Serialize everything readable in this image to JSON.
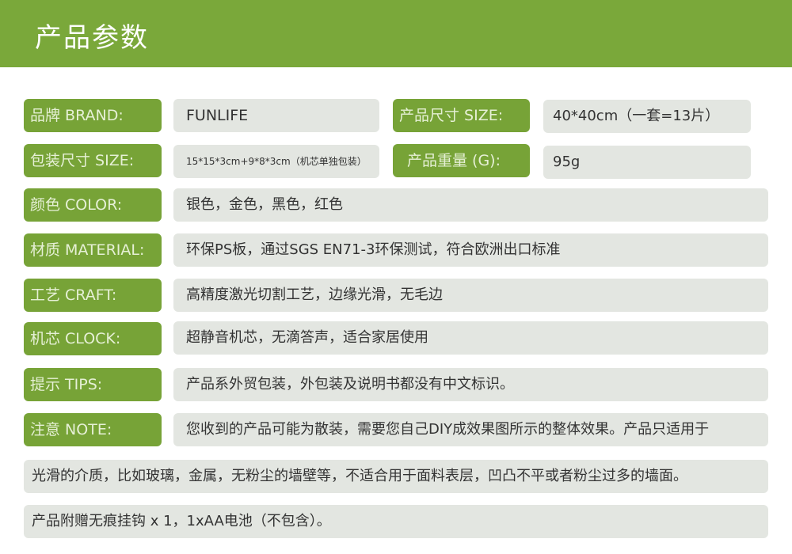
{
  "header": {
    "title": "产品参数"
  },
  "rows": {
    "brand": {
      "label": "品牌 BRAND:",
      "value": "FUNLIFE"
    },
    "size": {
      "label": "产品尺寸 SIZE:",
      "value": "40*40cm（一套=13片）"
    },
    "pack_size": {
      "label": "包装尺寸 SIZE:",
      "value": "15*15*3cm+9*8*3cm（机芯单独包装）"
    },
    "weight": {
      "label": "产品重量 (G):",
      "value": "95g"
    },
    "color": {
      "label": "颜色 COLOR:",
      "value": "银色，金色，黑色，红色"
    },
    "material": {
      "label": "材质 MATERIAL:",
      "value": "环保PS板，通过SGS EN71-3环保测试，符合欧洲出口标准"
    },
    "craft": {
      "label": "工艺 CRAFT:",
      "value": "高精度激光切割工艺，边缘光滑，无毛边"
    },
    "clock": {
      "label": "机芯 CLOCK:",
      "value": "超静音机芯，无滴答声，适合家居使用"
    },
    "tips": {
      "label": "提示  TIPS:",
      "value": "产品系外贸包装，外包装及说明书都没有中文标识。"
    },
    "note": {
      "label": "注意  NOTE:",
      "value": "您收到的产品可能为散装，需要您自己DIY成效果图所示的整体效果。产品只适用于"
    }
  },
  "note_continued": "光滑的介质，比如玻璃，金属，无粉尘的墙壁等，不适合用于面料表层，凹凸不平或者粉尘过多的墙面。",
  "gift": "产品附赠无痕挂钩 x 1，1xAA电池（不包含）。",
  "colors": {
    "header": "#7aa83a",
    "label": "#77a337",
    "value_bg": "#e3e6e1"
  }
}
